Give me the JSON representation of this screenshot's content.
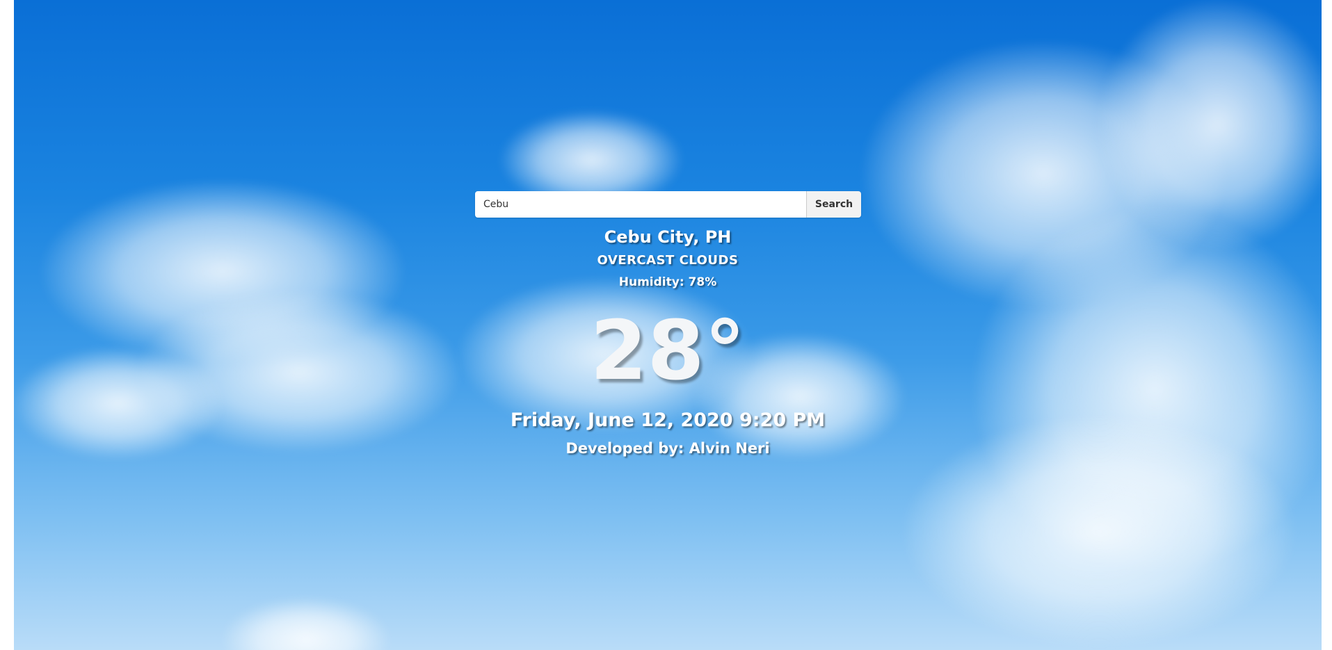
{
  "search": {
    "value": "Cebu",
    "button_label": "Search"
  },
  "weather": {
    "location": "Cebu City, PH",
    "description": "OVERCAST CLOUDS",
    "humidity": "Humidity: 78%",
    "temperature": "28°"
  },
  "footer": {
    "datetime": "Friday, June 12, 2020 9:20 PM",
    "developer": "Developed by: Alvin Neri"
  },
  "colors": {
    "sky_top": "#0a6fd6",
    "sky_bottom": "#b9dcf8",
    "text": "#ffffff"
  }
}
